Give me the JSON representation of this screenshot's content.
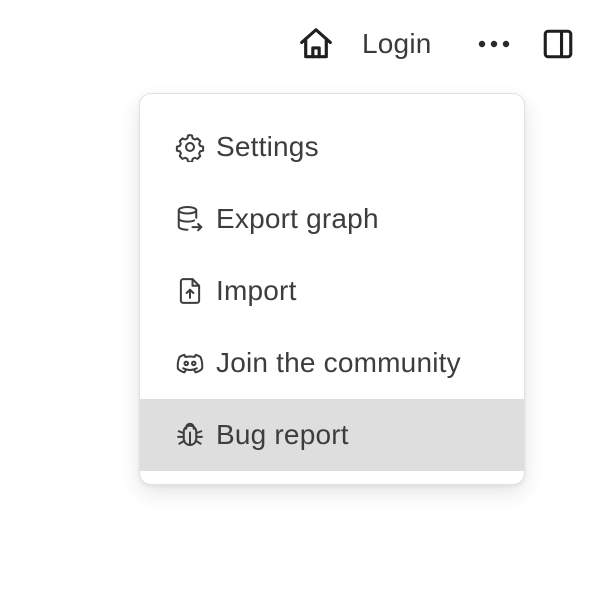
{
  "header": {
    "home_icon": "home-icon",
    "login_label": "Login",
    "more_icon": "more-horizontal-icon",
    "sidebar_icon": "panel-right-icon"
  },
  "menu": {
    "items": [
      {
        "label": "Settings",
        "icon": "gear-icon",
        "active": false
      },
      {
        "label": "Export graph",
        "icon": "database-export-icon",
        "active": false
      },
      {
        "label": "Import",
        "icon": "file-upload-icon",
        "active": false
      },
      {
        "label": "Join the community",
        "icon": "discord-icon",
        "active": false
      },
      {
        "label": "Bug report",
        "icon": "bug-icon",
        "active": true
      }
    ]
  },
  "colors": {
    "text": "#3d3d3d",
    "hover_background": "#dedede",
    "menu_border": "#e2e2e2",
    "background": "#ffffff"
  }
}
